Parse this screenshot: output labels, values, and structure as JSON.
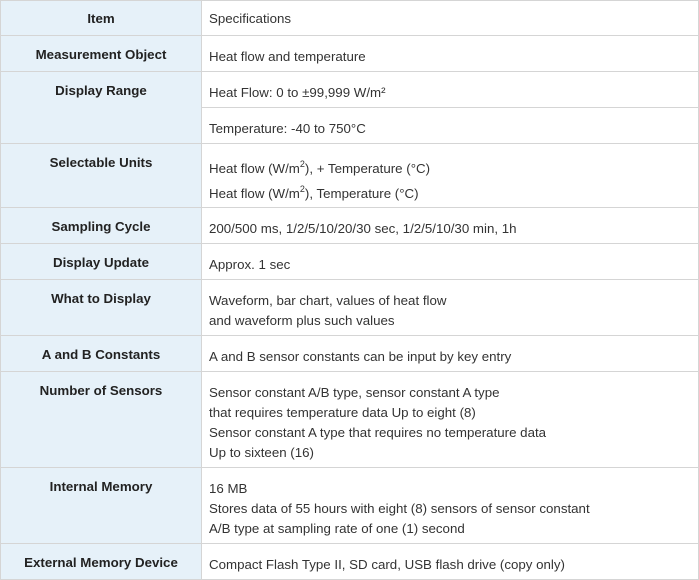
{
  "header": {
    "key": "Item",
    "value": "Specifications"
  },
  "rows": [
    {
      "key": "Measurement Object",
      "lines": [
        "Heat flow and temperature"
      ]
    },
    {
      "key": "Display Range",
      "lines": [
        "Heat Flow: 0 to ±99,999 W/m²"
      ]
    },
    {
      "key": "",
      "lines": [
        "Temperature: -40 to 750°C"
      ]
    },
    {
      "key": "Selectable Units",
      "lines": [
        {
          "pre": "Heat flow (W/m",
          "sup": "2",
          "post": "), + Temperature (°C)"
        },
        {
          "pre": "Heat flow (W/m",
          "sup": "2",
          "post": "), Temperature (°C)"
        }
      ]
    },
    {
      "key": "Sampling Cycle",
      "lines": [
        "200/500 ms, 1/2/5/10/20/30 sec, 1/2/5/10/30 min, 1h"
      ]
    },
    {
      "key": "Display Update",
      "lines": [
        "Approx. 1 sec"
      ]
    },
    {
      "key": "What to Display",
      "lines": [
        "Waveform, bar chart, values of heat flow",
        "and waveform plus such values"
      ]
    },
    {
      "key": "A and B Constants",
      "lines": [
        "A and B sensor constants can be input by key entry"
      ]
    },
    {
      "key": "Number of Sensors",
      "lines": [
        "Sensor constant A/B type, sensor constant A type",
        "that requires temperature data Up to eight (8)",
        "Sensor constant A type that requires no temperature data",
        "Up to sixteen (16)"
      ]
    },
    {
      "key": "Internal Memory",
      "lines": [
        "16 MB",
        "Stores data of 55 hours with eight (8) sensors of sensor constant",
        "A/B type at sampling rate of one (1) second"
      ]
    },
    {
      "key": "External Memory Device",
      "lines": [
        "Compact Flash Type II, SD card, USB flash drive (copy only)"
      ]
    }
  ]
}
